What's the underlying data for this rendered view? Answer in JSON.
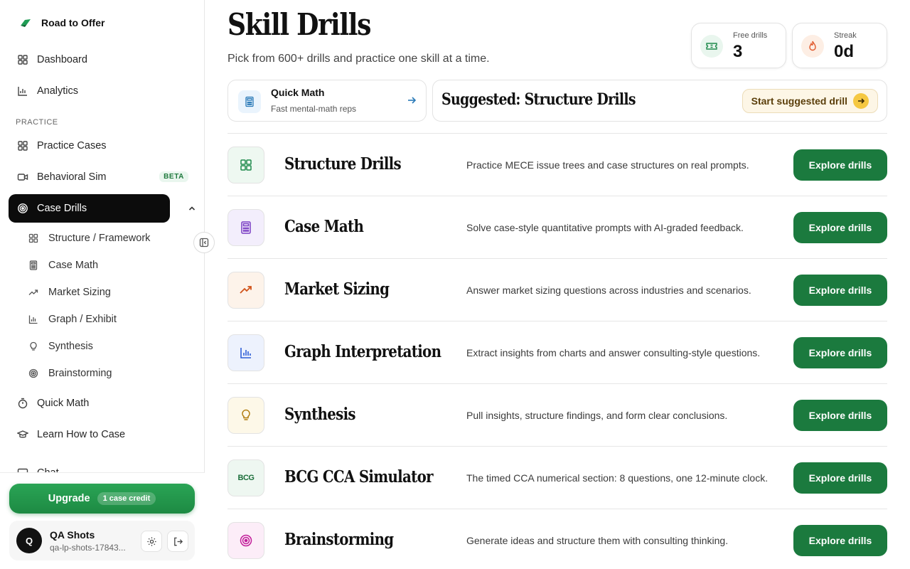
{
  "brand": {
    "name": "Road to Offer"
  },
  "nav": {
    "dashboard": "Dashboard",
    "analytics": "Analytics",
    "practice_section": "PRACTICE",
    "practice_cases": "Practice Cases",
    "behavioral_sim": "Behavioral Sim",
    "behavioral_badge": "BETA",
    "case_drills": "Case Drills",
    "sub_items": [
      "Structure / Framework",
      "Case Math",
      "Market Sizing",
      "Graph / Exhibit",
      "Synthesis",
      "Brainstorming"
    ],
    "quick_math": "Quick Math",
    "learn": "Learn How to Case",
    "partial_item": "Chat"
  },
  "upgrade": {
    "label": "Upgrade",
    "credit": "1 case credit"
  },
  "user": {
    "initial": "Q",
    "name": "QA Shots",
    "email": "qa-lp-shots-17843..."
  },
  "header": {
    "title": "Skill Drills",
    "subtitle": "Pick from 600+ drills and practice one skill at a time."
  },
  "stats": {
    "free_label": "Free drills",
    "free_value": "3",
    "streak_label": "Streak",
    "streak_value": "0d"
  },
  "quick_math_card": {
    "title": "Quick Math",
    "subtitle": "Fast mental-math reps"
  },
  "suggested": {
    "title": "Suggested: Structure Drills",
    "button": "Start suggested drill"
  },
  "drills": [
    {
      "title": "Structure Drills",
      "desc": "Practice MECE issue trees and case structures on real prompts.",
      "button": "Explore drills",
      "icon": "grid-icon",
      "color": "#1f8a4c",
      "bg": "#eef8f1"
    },
    {
      "title": "Case Math",
      "desc": "Solve case-style quantitative prompts with AI-graded feedback.",
      "button": "Explore drills",
      "icon": "calculator-icon",
      "color": "#7b3fc4",
      "bg": "#f3eefc"
    },
    {
      "title": "Market Sizing",
      "desc": "Answer market sizing questions across industries and scenarios.",
      "button": "Explore drills",
      "icon": "trending-up-icon",
      "color": "#d1531a",
      "bg": "#fdf3ea"
    },
    {
      "title": "Graph Interpretation",
      "desc": "Extract insights from charts and answer consulting-style questions.",
      "button": "Explore drills",
      "icon": "bar-chart-icon",
      "color": "#2f5fd6",
      "bg": "#edf2fd"
    },
    {
      "title": "Synthesis",
      "desc": "Pull insights, structure findings, and form clear conclusions.",
      "button": "Explore drills",
      "icon": "lightbulb-icon",
      "color": "#b07a0a",
      "bg": "#fdf8e8"
    },
    {
      "title": "BCG CCA Simulator",
      "desc": "The timed CCA numerical section: 8 questions, one 12-minute clock.",
      "button": "Explore drills",
      "icon": "bcg-logo-icon",
      "color": "#1b6e3a",
      "bg": "#eef7f1"
    },
    {
      "title": "Brainstorming",
      "desc": "Generate ideas and structure them with consulting thinking.",
      "button": "Explore drills",
      "icon": "target-icon",
      "color": "#c21e9a",
      "bg": "#fcedf8"
    }
  ],
  "bcg_logo_text": "BCG"
}
